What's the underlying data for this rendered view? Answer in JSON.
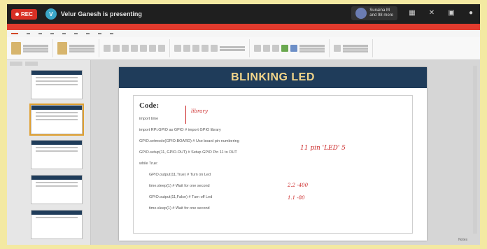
{
  "meeting": {
    "rec_label": "REC",
    "presenter_initial": "V",
    "presenter_text": "Velur Ganesh is presenting",
    "user_name": "Sunaina M",
    "user_sub": "and 98 more"
  },
  "slide": {
    "title": "BLINKING LED",
    "code_heading": "Code:",
    "lines": [
      "import time",
      "import RPi.GPIO as GPIO     # import GPIO library",
      "GPIO.setmode(GPIO.BOARD)     # Use board pin numbering",
      "GPIO.setup(11, GPIO.OUT)     # Setup GPIO Pin 11 to OUT",
      "while True:",
      "GPIO.output(11,True)  # Turn on Led",
      "time.sleep(1)      # Wait for one second",
      "GPIO.output(11,False) # Turn off Led",
      "time.sleep(1)      # Wait for one second"
    ],
    "annotations": [
      "library",
      "11 pin 'LED' 5",
      "2.2 -400",
      "1.1 -80"
    ],
    "notes_label": "Notes"
  },
  "colors": {
    "title_bar": "#1f3c5a",
    "title_text": "#f2d58a",
    "rec": "#d93025",
    "annotation": "#cc2a2a"
  }
}
